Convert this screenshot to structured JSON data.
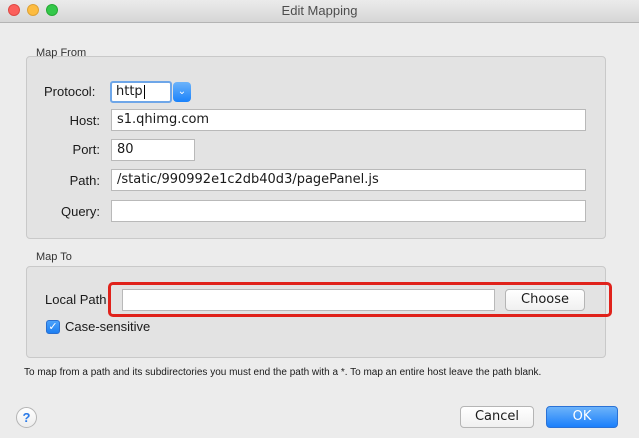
{
  "window": {
    "title": "Edit Mapping"
  },
  "map_from": {
    "title": "Map From",
    "protocol_label": "Protocol:",
    "protocol_value": "http",
    "host_label": "Host:",
    "host_value": "s1.qhimg.com",
    "port_label": "Port:",
    "port_value": "80",
    "path_label": "Path:",
    "path_value": "/static/990992e1c2db40d3/pagePanel.js",
    "query_label": "Query:",
    "query_value": ""
  },
  "map_to": {
    "title": "Map To",
    "local_path_label": "Local Path",
    "local_path_value": "",
    "choose_label": "Choose",
    "case_sensitive_label": "Case-sensitive",
    "case_sensitive_checked": true
  },
  "note": "To map from a path and its subdirectories you must end the path with a *. To map an entire host leave the path blank.",
  "buttons": {
    "help": "?",
    "cancel": "Cancel",
    "ok": "OK"
  },
  "icons": {
    "checkmark": "✓",
    "dropdown": "⌄"
  },
  "colors": {
    "highlight": "#e0221b",
    "accent": "#1b7ffb"
  }
}
